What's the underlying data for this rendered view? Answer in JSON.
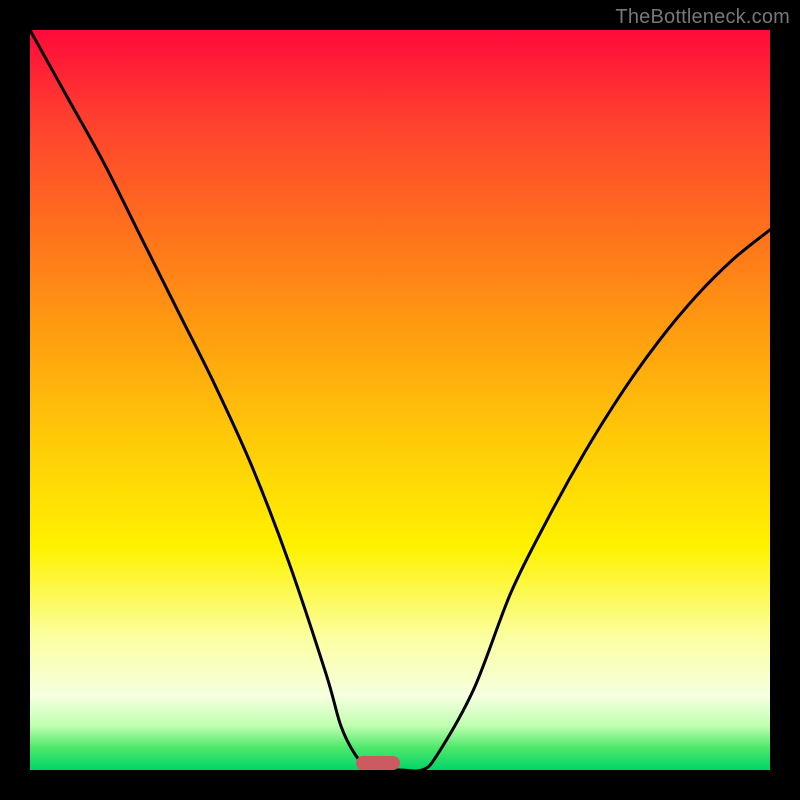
{
  "watermark": "TheBottleneck.com",
  "chart_data": {
    "type": "line",
    "title": "",
    "xlabel": "",
    "ylabel": "",
    "xlim": [
      0,
      100
    ],
    "ylim": [
      0,
      100
    ],
    "grid": false,
    "legend": false,
    "series": [
      {
        "name": "curve",
        "x": [
          0,
          5,
          10,
          15,
          20,
          25,
          30,
          35,
          40,
          42,
          44,
          46,
          47,
          50,
          53,
          55,
          60,
          65,
          70,
          75,
          80,
          85,
          90,
          95,
          100
        ],
        "values": [
          100,
          91,
          82,
          72,
          62,
          52,
          41,
          28,
          13,
          6,
          2,
          0,
          0,
          0,
          0,
          2,
          11,
          24,
          34,
          43,
          51,
          58,
          64,
          69,
          73
        ]
      }
    ],
    "marker": {
      "x": 47,
      "y": 1,
      "color": "#cc5a60"
    },
    "background_gradient": [
      {
        "stop": 0,
        "color": "#ff0a3a"
      },
      {
        "stop": 12,
        "color": "#ff3f2f"
      },
      {
        "stop": 25,
        "color": "#ff6a1f"
      },
      {
        "stop": 40,
        "color": "#ff9a10"
      },
      {
        "stop": 55,
        "color": "#ffc908"
      },
      {
        "stop": 70,
        "color": "#fff200"
      },
      {
        "stop": 82,
        "color": "#fbffa0"
      },
      {
        "stop": 90,
        "color": "#f6ffe0"
      },
      {
        "stop": 94,
        "color": "#c0ffb0"
      },
      {
        "stop": 97,
        "color": "#4de86a"
      },
      {
        "stop": 100,
        "color": "#00d468"
      }
    ]
  }
}
